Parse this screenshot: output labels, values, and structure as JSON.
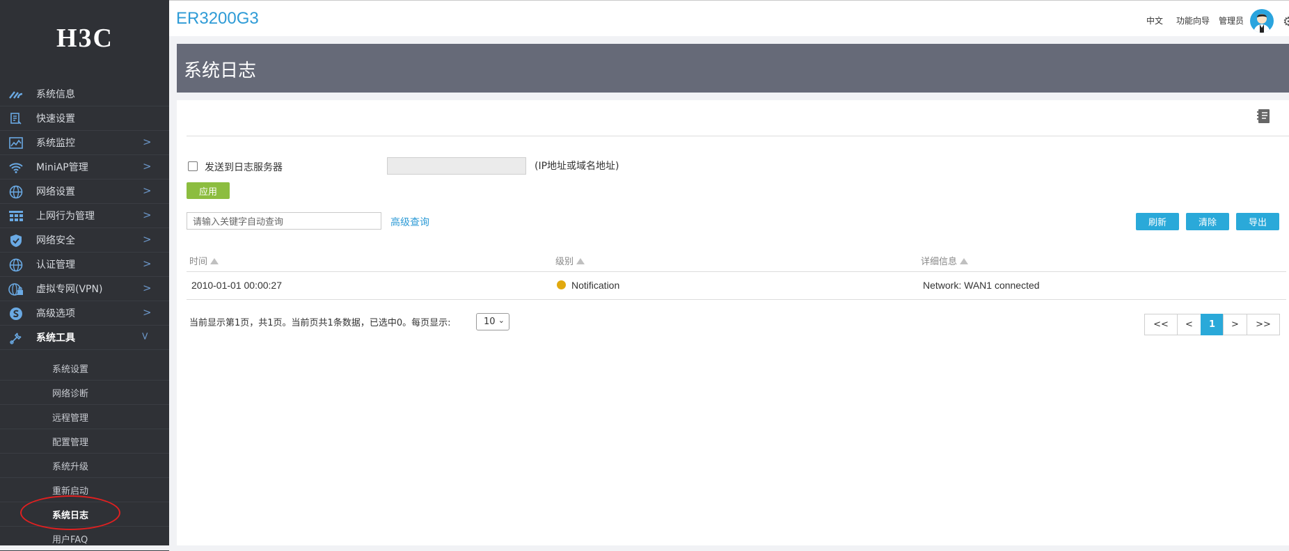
{
  "brand": {
    "logo_text": "H3C"
  },
  "sidebar": {
    "items": [
      {
        "label": "系统信息",
        "icon": "speedometer-icon"
      },
      {
        "label": "快速设置",
        "icon": "quick-settings-icon"
      },
      {
        "label": "系统监控",
        "icon": "monitor-chart-icon",
        "arrow": ">"
      },
      {
        "label": "MiniAP管理",
        "icon": "wifi-icon",
        "arrow": ">"
      },
      {
        "label": "网络设置",
        "icon": "globe-icon",
        "arrow": ">"
      },
      {
        "label": "上网行为管理",
        "icon": "firewall-icon",
        "arrow": ">"
      },
      {
        "label": "网络安全",
        "icon": "shield-icon",
        "arrow": ">"
      },
      {
        "label": "认证管理",
        "icon": "globe-icon",
        "arrow": ">"
      },
      {
        "label": "虚拟专网(VPN)",
        "icon": "vpn-globe-icon",
        "arrow": ">"
      },
      {
        "label": "高级选项",
        "icon": "advanced-icon",
        "arrow": ">"
      },
      {
        "label": "系统工具",
        "icon": "tools-icon",
        "arrow": "v"
      }
    ],
    "subitems": [
      {
        "label": "系统设置"
      },
      {
        "label": "网络诊断"
      },
      {
        "label": "远程管理"
      },
      {
        "label": "配置管理"
      },
      {
        "label": "系统升级"
      },
      {
        "label": "重新启动"
      },
      {
        "label": "系统日志"
      },
      {
        "label": "用户FAQ"
      }
    ]
  },
  "header": {
    "product": "ER3200G3",
    "language": "中文",
    "wizard": "功能向导",
    "user": "管理员"
  },
  "page": {
    "title": "系统日志"
  },
  "log_server": {
    "checkbox_label": "发送到日志服务器",
    "checked": false,
    "input_value": "",
    "hint": "(IP地址或域名地址)",
    "apply_label": "应用"
  },
  "search": {
    "placeholder": "请输入关键字自动查询",
    "advanced_label": "高级查询"
  },
  "toolbar": {
    "refresh": "刷新",
    "clear": "清除",
    "export": "导出"
  },
  "table": {
    "headers": [
      "时间",
      "级别",
      "详细信息"
    ],
    "rows": [
      {
        "time": "2010-01-01 00:00:27",
        "level": "Notification",
        "detail": "Network: WAN1 connected",
        "level_color": "#e1a90f"
      }
    ]
  },
  "pagination": {
    "summary": "当前显示第1页，共1页。当前页共1条数据，已选中0。每页显示:",
    "page_size": "10",
    "buttons": [
      "<<",
      "<",
      "1",
      ">",
      ">>"
    ],
    "current": "1"
  },
  "colors": {
    "accent": "#2aa9d9",
    "apply": "#8cbd3f",
    "sidebar_bg": "#2f3136",
    "banner_bg": "#666a78"
  }
}
